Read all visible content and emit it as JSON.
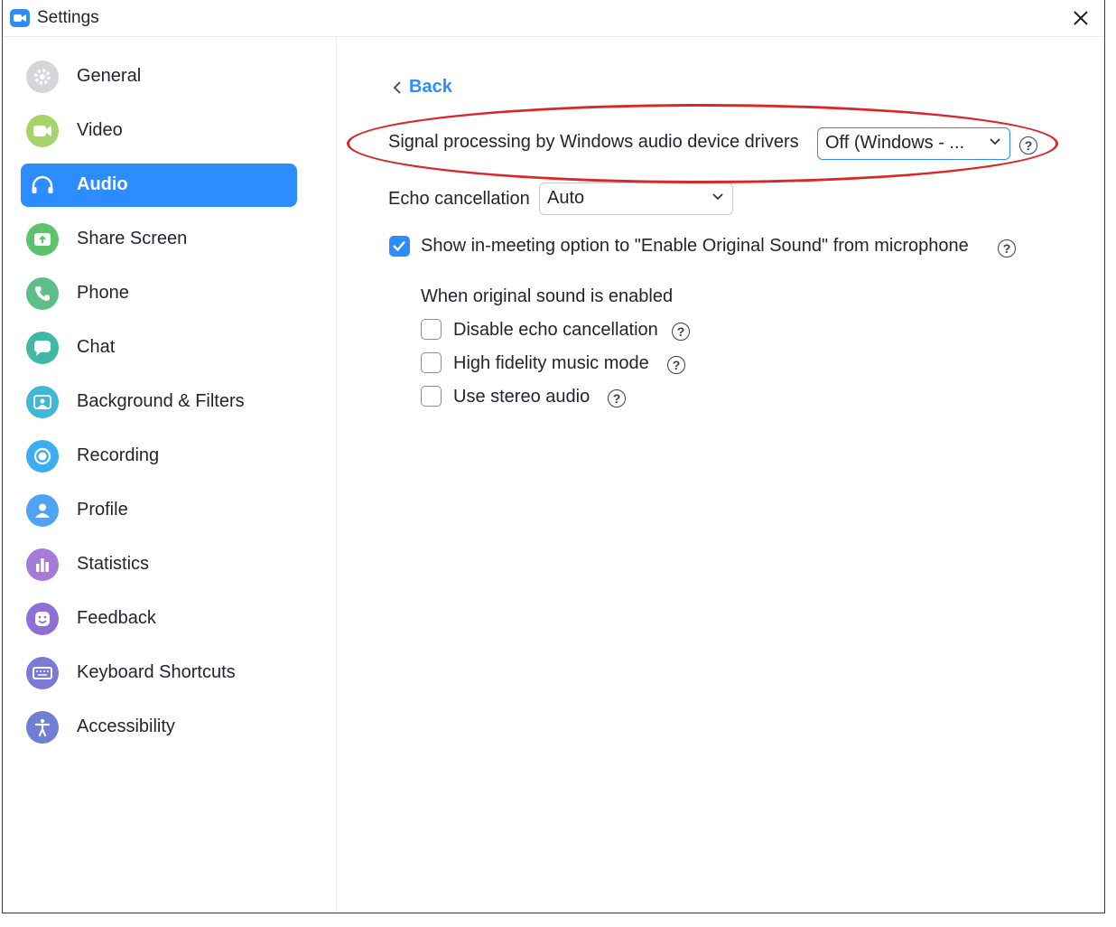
{
  "window": {
    "title": "Settings"
  },
  "sidebar": {
    "active": "Audio",
    "items": [
      {
        "label": "General",
        "icon": "gear-icon",
        "color": "#c8c8cc"
      },
      {
        "label": "Video",
        "icon": "video-camera-icon",
        "color": "#a5d46a"
      },
      {
        "label": "Audio",
        "icon": "headphones-icon",
        "color": "#2d8cff"
      },
      {
        "label": "Share Screen",
        "icon": "share-screen-icon",
        "color": "#5cc26c"
      },
      {
        "label": "Phone",
        "icon": "phone-icon",
        "color": "#5cbf8a"
      },
      {
        "label": "Chat",
        "icon": "chat-bubble-icon",
        "color": "#41b8a4"
      },
      {
        "label": "Background & Filters",
        "icon": "background-icon",
        "color": "#3db8d8"
      },
      {
        "label": "Recording",
        "icon": "record-icon",
        "color": "#3aaef0"
      },
      {
        "label": "Profile",
        "icon": "profile-icon",
        "color": "#4ea3f5"
      },
      {
        "label": "Statistics",
        "icon": "bar-chart-icon",
        "color": "#a67bd6"
      },
      {
        "label": "Feedback",
        "icon": "smiley-icon",
        "color": "#8e6fd6"
      },
      {
        "label": "Keyboard Shortcuts",
        "icon": "keyboard-icon",
        "color": "#7c79d8"
      },
      {
        "label": "Accessibility",
        "icon": "accessibility-icon",
        "color": "#6f7fd4"
      }
    ]
  },
  "content": {
    "back_label": "Back",
    "signal_processing": {
      "label": "Signal processing by Windows audio device drivers",
      "value": "Off (Windows - ..."
    },
    "echo_cancellation": {
      "label": "Echo cancellation",
      "value": "Auto"
    },
    "original_sound_option": {
      "label": "Show in-meeting option to \"Enable Original Sound\" from microphone",
      "checked": true
    },
    "original_sound_heading": "When original sound is enabled",
    "original_sound_options": [
      {
        "label": "Disable echo cancellation",
        "checked": false
      },
      {
        "label": "High fidelity music mode",
        "checked": false
      },
      {
        "label": "Use stereo audio",
        "checked": false
      }
    ],
    "help_symbol": "?"
  },
  "annotation_color": "#d8282a"
}
